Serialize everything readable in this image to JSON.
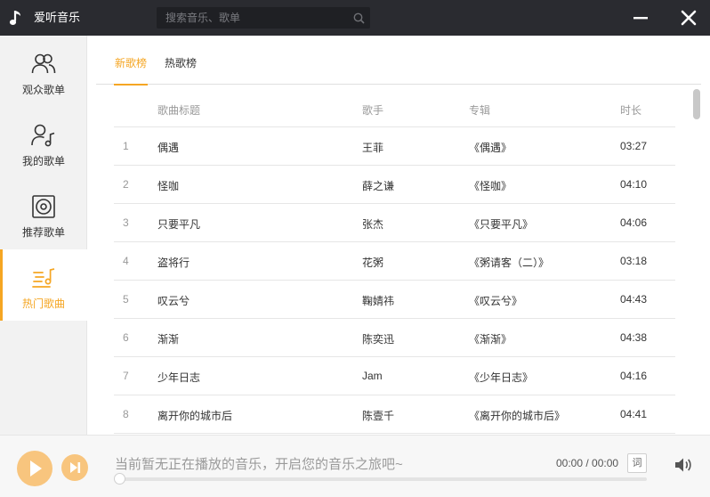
{
  "app": {
    "title": "爱听音乐",
    "logo_icon": "music-note-icon"
  },
  "search": {
    "placeholder": "搜索音乐、歌单",
    "value": ""
  },
  "window_controls": {
    "minimize_icon": "minimize-icon",
    "close_icon": "close-icon"
  },
  "sidebar": {
    "items": [
      {
        "label": "观众歌单",
        "icon": "users-icon",
        "active": false
      },
      {
        "label": "我的歌单",
        "icon": "user-music-icon",
        "active": false
      },
      {
        "label": "推荐歌单",
        "icon": "vinyl-record-icon",
        "active": false
      },
      {
        "label": "热门歌曲",
        "icon": "hot-songs-icon",
        "active": true
      }
    ]
  },
  "tabs": [
    {
      "label": "新歌榜",
      "active": true
    },
    {
      "label": "热歌榜",
      "active": false
    }
  ],
  "table": {
    "columns": [
      "歌曲标题",
      "歌手",
      "专辑",
      "时长"
    ],
    "rows": [
      {
        "num": "1",
        "title": "偶遇",
        "artist": "王菲",
        "album": "《偶遇》",
        "duration": "03:27"
      },
      {
        "num": "2",
        "title": "怪咖",
        "artist": "薛之谦",
        "album": "《怪咖》",
        "duration": "04:10"
      },
      {
        "num": "3",
        "title": "只要平凡",
        "artist": "张杰",
        "album": "《只要平凡》",
        "duration": "04:06"
      },
      {
        "num": "4",
        "title": "盗将行",
        "artist": "花粥",
        "album": "《粥请客（二）》",
        "duration": "03:18"
      },
      {
        "num": "5",
        "title": "叹云兮",
        "artist": "鞠婧祎",
        "album": "《叹云兮》",
        "duration": "04:43"
      },
      {
        "num": "6",
        "title": "渐渐",
        "artist": "陈奕迅",
        "album": "《渐渐》",
        "duration": "04:38"
      },
      {
        "num": "7",
        "title": "少年日志",
        "artist": "Jam",
        "album": "《少年日志》",
        "duration": "04:16"
      },
      {
        "num": "8",
        "title": "离开你的城市后",
        "artist": "陈壹千",
        "album": "《离开你的城市后》",
        "duration": "04:41"
      }
    ]
  },
  "player": {
    "now_playing": "当前暂无正在播放的音乐，开启您的音乐之旅吧~",
    "time": "00:00 / 00:00",
    "lyric_label": "词",
    "progress": 0
  },
  "colors": {
    "accent": "#f5a623",
    "titlebar": "#2a2b30",
    "button": "#f8c57e"
  }
}
